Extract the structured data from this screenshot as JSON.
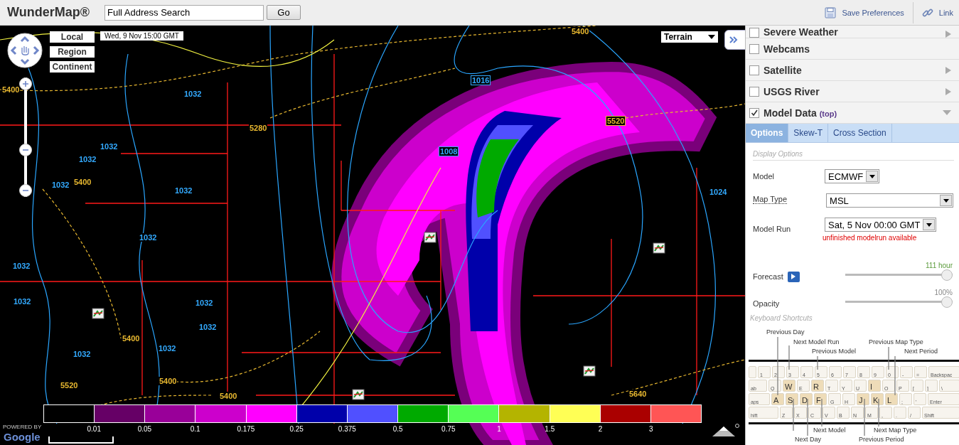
{
  "header": {
    "title": "WunderMap®",
    "search": {
      "value": "Full Address Search"
    },
    "go_button": "Go",
    "actions": [
      {
        "kind": "save",
        "label": "Save Preferences"
      },
      {
        "kind": "link",
        "label": "Link"
      }
    ]
  },
  "map": {
    "zoom": {
      "level": 0.38
    },
    "zoom_levels": [
      "Local",
      "Region",
      "Continent"
    ],
    "date": "Wed, 9 Nov 15:00 GMT",
    "base_layer": "Terrain",
    "contour_labels": [
      {
        "text": "5400",
        "color": "#e8b830"
      },
      {
        "text": "1032",
        "color": "#33aaff"
      },
      {
        "text": "1032",
        "color": "#33aaff"
      },
      {
        "text": "1032",
        "color": "#33aaff"
      },
      {
        "text": "5400",
        "color": "#e8b830"
      },
      {
        "text": "1032",
        "color": "#33aaff"
      },
      {
        "text": "1032",
        "color": "#33aaff"
      },
      {
        "text": "1032",
        "color": "#33aaff"
      },
      {
        "text": "1032",
        "color": "#33aaff"
      },
      {
        "text": "1032",
        "color": "#33aaff"
      },
      {
        "text": "1032",
        "color": "#33aaff"
      },
      {
        "text": "5400",
        "color": "#e8b830"
      },
      {
        "text": "1032",
        "color": "#33aaff"
      },
      {
        "text": "1032",
        "color": "#33aaff"
      },
      {
        "text": "1032",
        "color": "#33aaff"
      },
      {
        "text": "5400",
        "color": "#e8b830"
      },
      {
        "text": "5400",
        "color": "#e8b830"
      },
      {
        "text": "5520",
        "color": "#e8b830"
      },
      {
        "text": "5280",
        "color": "#e8b830"
      },
      {
        "text": "1016",
        "color": "#33aaff"
      },
      {
        "text": "1008",
        "color": "#33aaff"
      },
      {
        "text": "5520",
        "color": "#e8b830"
      },
      {
        "text": "5400",
        "color": "#e8b830"
      },
      {
        "text": "1024",
        "color": "#33aaff"
      },
      {
        "text": "5640",
        "color": "#e8b830"
      }
    ],
    "legend": {
      "cells": [
        {
          "color": "#000000"
        },
        {
          "color": "#660066"
        },
        {
          "color": "#990099"
        },
        {
          "color": "#cc00cc"
        },
        {
          "color": "#ff00ff"
        },
        {
          "color": "#0000aa"
        },
        {
          "color": "#5050ff"
        },
        {
          "color": "#00aa00"
        },
        {
          "color": "#55ff55"
        },
        {
          "color": "#b4b400"
        },
        {
          "color": "#ffff55"
        },
        {
          "color": "#aa0000"
        },
        {
          "color": "#ff5555"
        }
      ],
      "ticks": [
        "0.01",
        "0.05",
        "0.1",
        "0.175",
        "0.25",
        "0.375",
        "0.5",
        "0.75",
        "1",
        "1.5",
        "2",
        "3"
      ]
    },
    "attribution": [
      "POWERED BY",
      "Google"
    ]
  },
  "layers": [
    {
      "label": "Severe Weather",
      "checked": false,
      "expandable": true,
      "expanded": false
    },
    {
      "label": "Webcams",
      "checked": false,
      "expandable": false
    },
    {
      "label": "Satellite",
      "checked": false,
      "expandable": true,
      "expanded": false
    },
    {
      "label": "USGS River",
      "checked": false,
      "expandable": true,
      "expanded": false
    },
    {
      "label": "Model Data",
      "tag": "(top)",
      "checked": true,
      "expandable": true,
      "expanded": true
    }
  ],
  "tabs": [
    {
      "label": "Options",
      "selected": true
    },
    {
      "label": "Skew-T",
      "selected": false
    },
    {
      "label": "Cross Section",
      "selected": false
    }
  ],
  "options": {
    "heading": "Display Options",
    "fields": [
      {
        "label": "Model",
        "value": "ECMWF",
        "dotted": false
      },
      {
        "label": "Map Type",
        "value": "MSL",
        "dotted": true
      },
      {
        "label": "Model Run",
        "value": "Sat, 5 Nov 00:00 GMT",
        "dotted": false
      }
    ],
    "warning": "unfinished modelrun available",
    "sliders": [
      {
        "label": "Forecast",
        "play": true,
        "reading": "111 hour",
        "level": 1
      },
      {
        "label": "Opacity",
        "play": false,
        "reading": "100%",
        "level": 1
      }
    ]
  },
  "keyboard": {
    "heading": "Keyboard Shortcuts",
    "rows": [
      {
        "keys": [
          {
            "highlighted": false
          },
          {
            "label": "1",
            "highlighted": false
          },
          {
            "label": "2",
            "highlighted": false
          },
          {
            "label": "3",
            "highlighted": false
          },
          {
            "label": "4",
            "highlighted": false
          },
          {
            "label": "5",
            "highlighted": false
          },
          {
            "label": "6",
            "highlighted": false
          },
          {
            "label": "7",
            "highlighted": false
          },
          {
            "label": "8",
            "highlighted": false
          },
          {
            "label": "9",
            "highlighted": false
          },
          {
            "label": "0",
            "highlighted": false
          },
          {
            "label": "-",
            "highlighted": false
          },
          {
            "label": "=",
            "highlighted": false
          },
          {
            "label": "Backspac",
            "highlighted": false
          }
        ]
      },
      {
        "keys": [
          {
            "label": "ab",
            "highlighted": false
          },
          {
            "label": "Q",
            "highlighted": false
          },
          {
            "label": "W",
            "highlighted": true
          },
          {
            "label": "E",
            "highlighted": false
          },
          {
            "label": "R",
            "highlighted": true
          },
          {
            "label": "T",
            "highlighted": false
          },
          {
            "label": "Y",
            "highlighted": false
          },
          {
            "label": "U",
            "highlighted": false
          },
          {
            "label": "I",
            "highlighted": true
          },
          {
            "label": "O",
            "highlighted": false
          },
          {
            "label": "P",
            "highlighted": false
          },
          {
            "label": "[",
            "highlighted": false
          },
          {
            "label": "]",
            "highlighted": false
          },
          {
            "label": "\\",
            "highlighted": false
          }
        ]
      },
      {
        "keys": [
          {
            "label": "aps",
            "highlighted": false
          },
          {
            "label": "A",
            "highlighted": true
          },
          {
            "label": "S",
            "highlighted": true
          },
          {
            "label": "D",
            "highlighted": true
          },
          {
            "label": "F",
            "highlighted": true
          },
          {
            "label": "G",
            "highlighted": false
          },
          {
            "label": "H",
            "highlighted": false
          },
          {
            "label": "J",
            "highlighted": true
          },
          {
            "label": "K",
            "highlighted": true
          },
          {
            "label": "L",
            "highlighted": true
          },
          {
            "label": ";",
            "highlighted": false
          },
          {
            "label": "'",
            "highlighted": false
          },
          {
            "label": "Enter",
            "highlighted": false
          }
        ]
      },
      {
        "keys": [
          {
            "label": "hift",
            "highlighted": false
          },
          {
            "label": "Z",
            "highlighted": false
          },
          {
            "label": "X",
            "highlighted": false
          },
          {
            "label": "C",
            "highlighted": false
          },
          {
            "label": "V",
            "highlighted": false
          },
          {
            "label": "B",
            "highlighted": false
          },
          {
            "label": "N",
            "highlighted": false
          },
          {
            "label": "M",
            "highlighted": false
          },
          {
            "label": ",",
            "highlighted": false
          },
          {
            "label": ".",
            "highlighted": false
          },
          {
            "label": "/",
            "highlighted": false
          },
          {
            "label": "Shift",
            "highlighted": false
          }
        ]
      }
    ],
    "callouts": [
      "Previous Day",
      "Next Model Run",
      "Previous Model",
      "Previous Map Type",
      "Next Period",
      "Next Model",
      "Next Map Type",
      "Next Day",
      "Previous Period"
    ]
  }
}
